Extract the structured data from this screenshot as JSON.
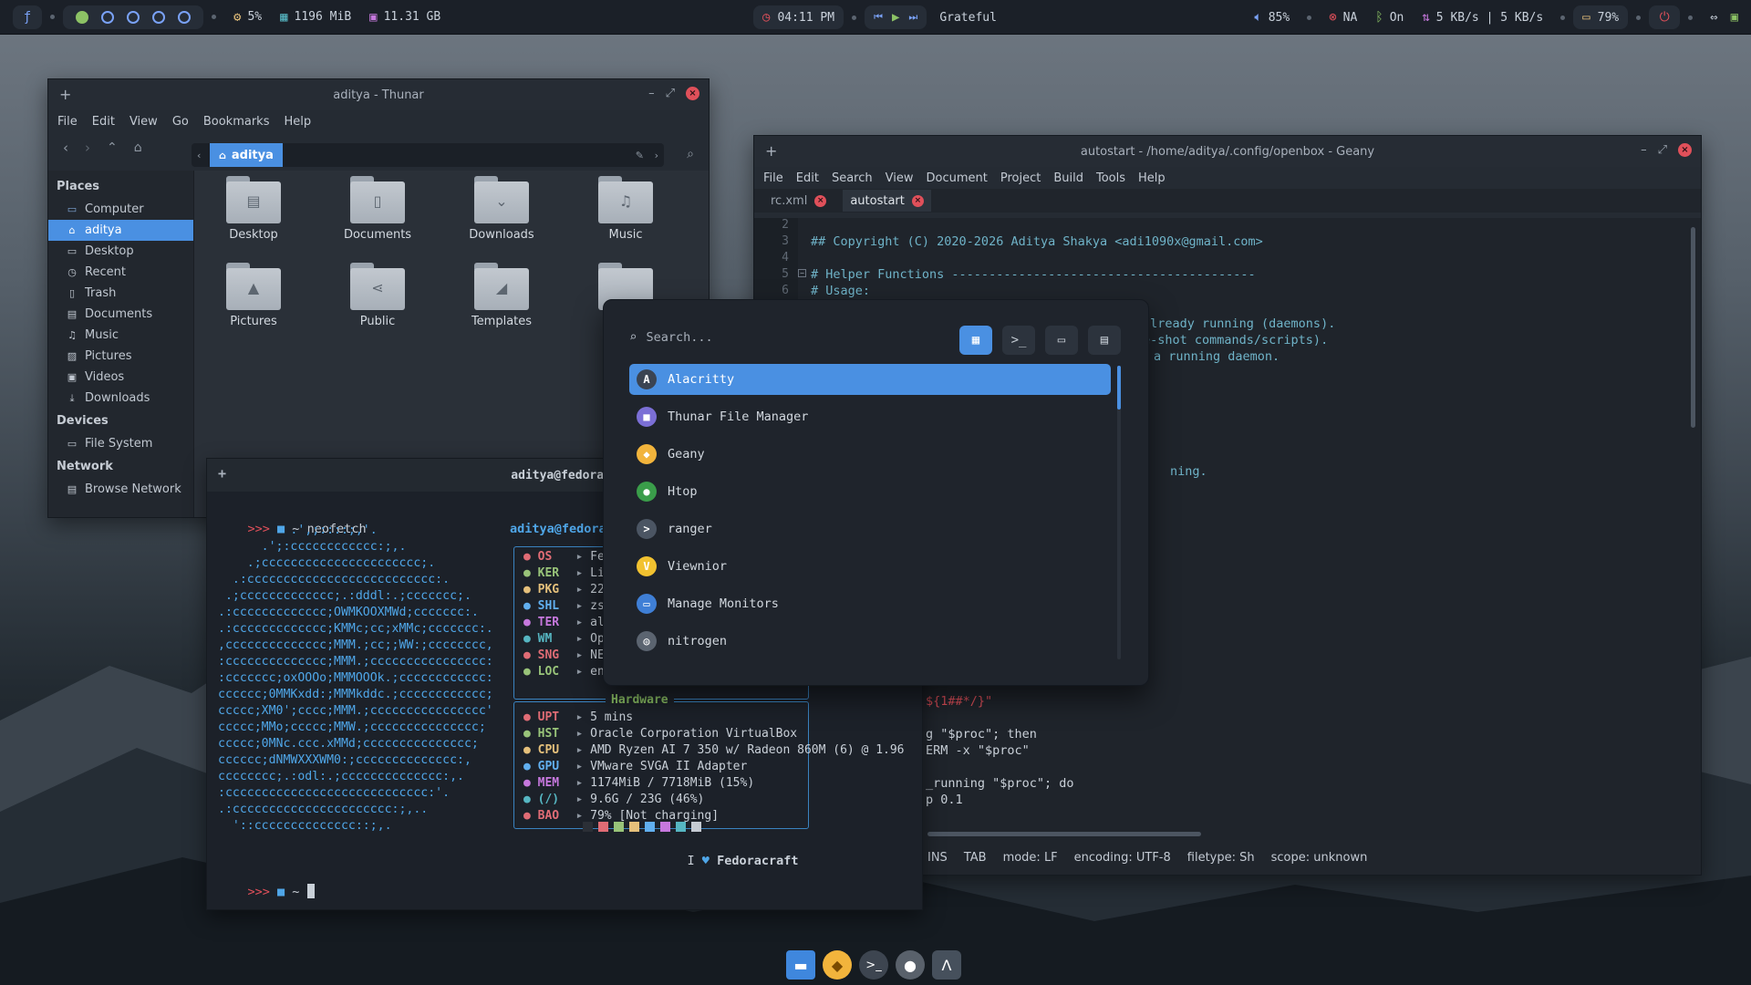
{
  "topbar": {
    "cpu": "5%",
    "memory": "1196 MiB",
    "disk": "11.31 GB",
    "clock": "04:11 PM",
    "song": "Grateful",
    "volume": "85%",
    "network": "NA",
    "bluetooth": "On",
    "net_speed": "5 KB/s | 5 KB/s",
    "battery": "79%"
  },
  "thunar": {
    "title": "aditya - Thunar",
    "menu": [
      "File",
      "Edit",
      "View",
      "Go",
      "Bookmarks",
      "Help"
    ],
    "path": "aditya",
    "sidebar": {
      "places_header": "Places",
      "places": [
        "Computer",
        "aditya",
        "Desktop",
        "Recent",
        "Trash",
        "Documents",
        "Music",
        "Pictures",
        "Videos",
        "Downloads"
      ],
      "devices_header": "Devices",
      "devices": [
        "File System"
      ],
      "network_header": "Network",
      "network": [
        "Browse Network"
      ]
    },
    "folders": [
      "Desktop",
      "Documents",
      "Downloads",
      "Music",
      "Pictures",
      "Public",
      "Templates"
    ]
  },
  "geany": {
    "title": "autostart - /home/aditya/.config/openbox - Geany",
    "menu": [
      "File",
      "Edit",
      "Search",
      "View",
      "Document",
      "Project",
      "Build",
      "Tools",
      "Help"
    ],
    "tabs": [
      "rc.xml",
      "autostart"
    ],
    "line_numbers": [
      "2",
      "3",
      "4",
      "5",
      "6"
    ],
    "code": {
      "l3": "## Copyright (C) 2020-2026 Aditya Shakya <adi1090x@gmail.com>",
      "l5": "# Helper Functions -----------------------------------------",
      "l6": "# Usage:",
      "c1": "already running (daemons).",
      "c2": "e-shot commands/scripts).",
      "c3": "a running daemon.",
      "c4": "ning.",
      "c5": "${1##*/}\"",
      "c6": "g \"$proc\"; then",
      "c7": "ERM -x \"$proc\"",
      "c8": "_running \"$proc\"; do",
      "c9": "p 0.1"
    },
    "status": [
      "INS",
      "TAB",
      "mode: LF",
      "encoding: UTF-8",
      "filetype: Sh",
      "scope: unknown"
    ]
  },
  "terminal": {
    "title": "aditya@fedora:~",
    "prompt": ">>> ",
    "home": "~",
    "command": "neofetch",
    "user_host": "aditya@fedora",
    "ascii": "          .',;::::;,'.\n      .';:cccccccccccc:;,.\n    .;cccccccccccccccccccccc;.\n  .:cccccccccccccccccccccccccc:.\n .;ccccccccccccc;.:dddl:.;ccccccc;.\n.:ccccccccccccc;OWMKOOXMWd;ccccccc:.\n.:ccccccccccccc;KMMc;cc;xMMc;ccccccc:.\n,cccccccccccccc;MMM.;cc;;WW:;cccccccc,\n:cccccccccccccc;MMM.;cccccccccccccccc:\n:ccccccc;oxOOOo;MMMOOOk.;cccccccccccc:\ncccccc;0MMKxdd:;MMMkddc.;cccccccccccc;\nccccc;XM0';cccc;MMM.;cccccccccccccccc'\nccccc;MMo;ccccc;MMW.;ccccccccccccccc;\nccccc;0MNc.ccc.xMMd;ccccccccccccccc;\ncccccc;dNMWXXXWM0:;cccccccccccccc:,\ncccccccc;.:odl:.;cccccccccccccc:,.\n:cccccccccccccccccccccccccccc:'.\n.:cccccccccccccccccccccc:;,..\n  '::cccccccccccccc::;,.",
    "info": [
      {
        "k": "OS",
        "v": "Fec",
        "c": "#e06c75"
      },
      {
        "k": "KER",
        "v": "Lir",
        "c": "#98c379"
      },
      {
        "k": "PKG",
        "v": "227",
        "c": "#e5c07b"
      },
      {
        "k": "SHL",
        "v": "zsh",
        "c": "#61afef"
      },
      {
        "k": "TER",
        "v": "ala",
        "c": "#c678dd"
      },
      {
        "k": "WM",
        "v": "Ope",
        "c": "#56b6c2"
      },
      {
        "k": "SNG",
        "v": "NEF",
        "c": "#e06c75"
      },
      {
        "k": "LOC",
        "v": "en_",
        "c": "#98c379"
      }
    ],
    "hardware_label": "Hardware",
    "hardware": [
      {
        "k": "UPT",
        "v": "5 mins",
        "c": "#e06c75"
      },
      {
        "k": "HST",
        "v": "Oracle Corporation VirtualBox",
        "c": "#98c379"
      },
      {
        "k": "CPU",
        "v": "AMD Ryzen AI 7 350 w/ Radeon 860M (6) @ 1.96",
        "c": "#e5c07b"
      },
      {
        "k": "GPU",
        "v": "VMware SVGA II Adapter",
        "c": "#61afef"
      },
      {
        "k": "MEM",
        "v": "1174MiB / 7718MiB (15%)",
        "c": "#c678dd"
      },
      {
        "k": "(/)",
        "v": "9.6G / 23G (46%)",
        "c": "#56b6c2"
      },
      {
        "k": "BAO",
        "v": "79% [Not charging]",
        "c": "#e06c75"
      }
    ],
    "palette": [
      "#2b2f36",
      "#e06c75",
      "#98c379",
      "#e5c07b",
      "#61afef",
      "#c678dd",
      "#56b6c2",
      "#c5cbd3"
    ],
    "love_text": "I",
    "love_name": "Fedoracraft"
  },
  "launcher": {
    "placeholder": "Search...",
    "apps": [
      {
        "name": "Alacritty",
        "color": "#3b4452",
        "glyph": "A"
      },
      {
        "name": "Thunar File Manager",
        "color": "#7b6fd6",
        "glyph": "■"
      },
      {
        "name": "Geany",
        "color": "#f2b43c",
        "glyph": "◆"
      },
      {
        "name": "Htop",
        "color": "#3a9d4a",
        "glyph": "●"
      },
      {
        "name": "ranger",
        "color": "#4b5563",
        "glyph": ">"
      },
      {
        "name": "Viewnior",
        "color": "#f2c230",
        "glyph": "V"
      },
      {
        "name": "Manage Monitors",
        "color": "#3f7fd6",
        "glyph": "▭"
      },
      {
        "name": "nitrogen",
        "color": "#5b6470",
        "glyph": "◎"
      }
    ]
  },
  "dock": [
    "files",
    "geany",
    "terminal",
    "settings",
    "alacritty"
  ]
}
